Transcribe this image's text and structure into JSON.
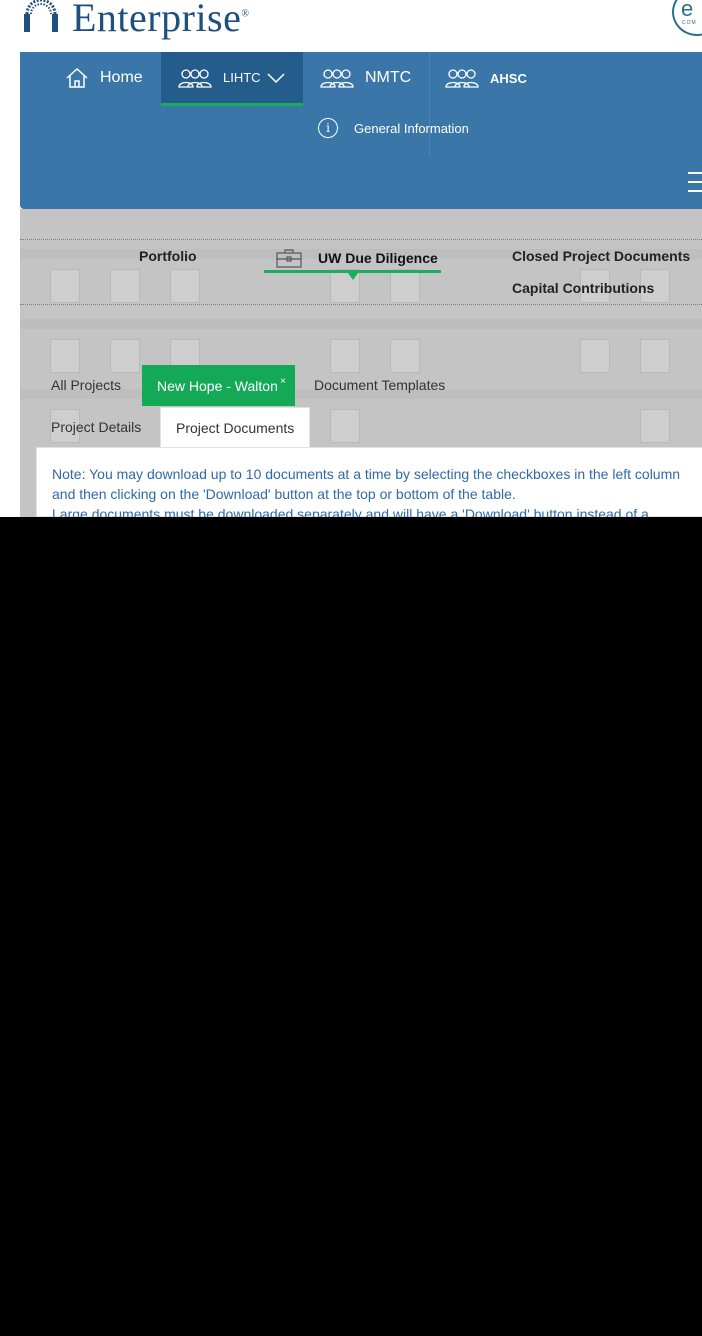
{
  "brand": {
    "name": "Enterprise",
    "reg_mark": "®",
    "partner_initials": "e",
    "partner_sub": "COM"
  },
  "nav": {
    "items": [
      {
        "label": "Home",
        "icon": "home-icon"
      },
      {
        "label": "LIHTC",
        "icon": "people-icon",
        "active": true
      },
      {
        "label": "NMTC",
        "icon": "people-icon"
      },
      {
        "label": "AHSC",
        "icon": "people-icon"
      }
    ],
    "submenu": {
      "label": "General Information",
      "icon": "info-icon"
    }
  },
  "subtabs": {
    "portfolio": "Portfolio",
    "uw_due_diligence": "UW Due Diligence",
    "closed_docs": "Closed Project Documents",
    "capital_contributions": "Capital Contributions"
  },
  "project_tabs": {
    "all_projects": "All Projects",
    "current_project": "New Hope - Walton",
    "close_symbol": "×",
    "document_templates": "Document Templates",
    "project_details": "Project Details",
    "project_documents": "Project Documents"
  },
  "note": {
    "line1": "Note: You may download up to 10 documents at a time by selecting the checkboxes in the left column",
    "line2": "and then clicking on the 'Download' button at the top or bottom of the table.",
    "line3": "Large documents must be downloaded separately and will have a 'Download' button instead of a"
  },
  "colors": {
    "nav_blue": "#3a77a8",
    "nav_active": "#245c8c",
    "accent_green": "#14a957",
    "note_text": "#2f6aa8"
  }
}
